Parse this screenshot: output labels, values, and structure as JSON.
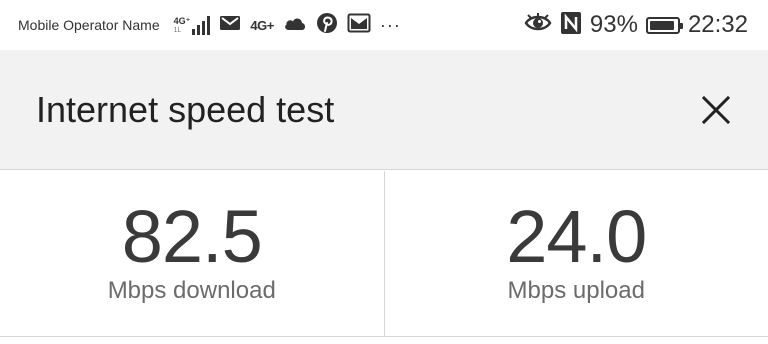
{
  "status_bar": {
    "operator": "Mobile Operator Name",
    "network_main": "4G⁺",
    "network_sub": "1L",
    "network_secondary": "4G+",
    "overflow": "···",
    "battery_percent": "93%",
    "battery_level": 0.93,
    "time": "22:32",
    "icons": [
      "signal-icon",
      "mail-icon",
      "cloud-icon",
      "pinterest-icon",
      "mail-icon",
      "eye-icon",
      "nfc-icon",
      "battery-icon"
    ]
  },
  "app_bar": {
    "title": "Internet speed test",
    "close_icon": "close-icon"
  },
  "results": {
    "download": {
      "value": "82.5",
      "label": "Mbps download"
    },
    "upload": {
      "value": "24.0",
      "label": "Mbps upload"
    }
  },
  "colors": {
    "header_bg": "#f2f2f2",
    "divider": "#d6d6d6",
    "value_text": "#3a3a3a",
    "label_text": "#6b6b6b"
  }
}
